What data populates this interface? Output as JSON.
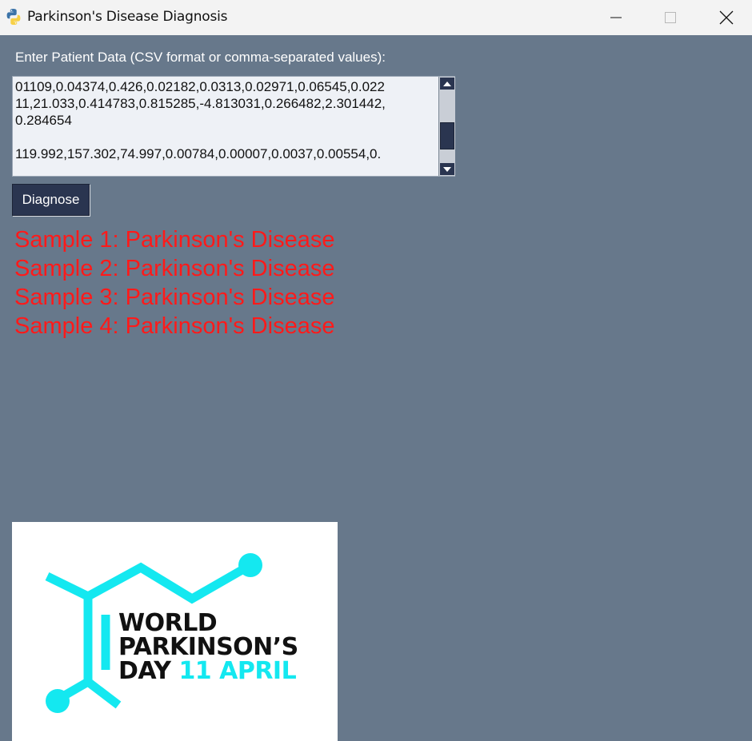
{
  "window": {
    "title": "Parkinson's Disease Diagnosis"
  },
  "form": {
    "prompt": "Enter Patient Data (CSV format or comma-separated values):",
    "input_value": "01109,0.04374,0.426,0.02182,0.0313,0.02971,0.06545,0.022\n11,21.033,0.414783,0.815285,-4.813031,0.266482,2.301442,\n0.284654\n\n119.992,157.302,74.997,0.00784,0.00007,0.0037,0.00554,0.",
    "diagnose_label": "Diagnose"
  },
  "results": [
    "Sample 1: Parkinson's Disease",
    "Sample 2: Parkinson's Disease",
    "Sample 3: Parkinson's Disease",
    "Sample 4: Parkinson's Disease"
  ],
  "logo": {
    "line1": "WORLD",
    "line2": "PARKINSON’S",
    "line3_prefix": "DAY",
    "line3_accent": "11 APRIL"
  },
  "icons": {
    "app": "python-icon",
    "minimize": "minimize-icon",
    "maximize": "maximize-icon",
    "close": "close-icon"
  },
  "colors": {
    "background": "#67788b",
    "result_text": "#ff1a1a",
    "logo_accent": "#14e8f0",
    "button": "#2a3550"
  }
}
